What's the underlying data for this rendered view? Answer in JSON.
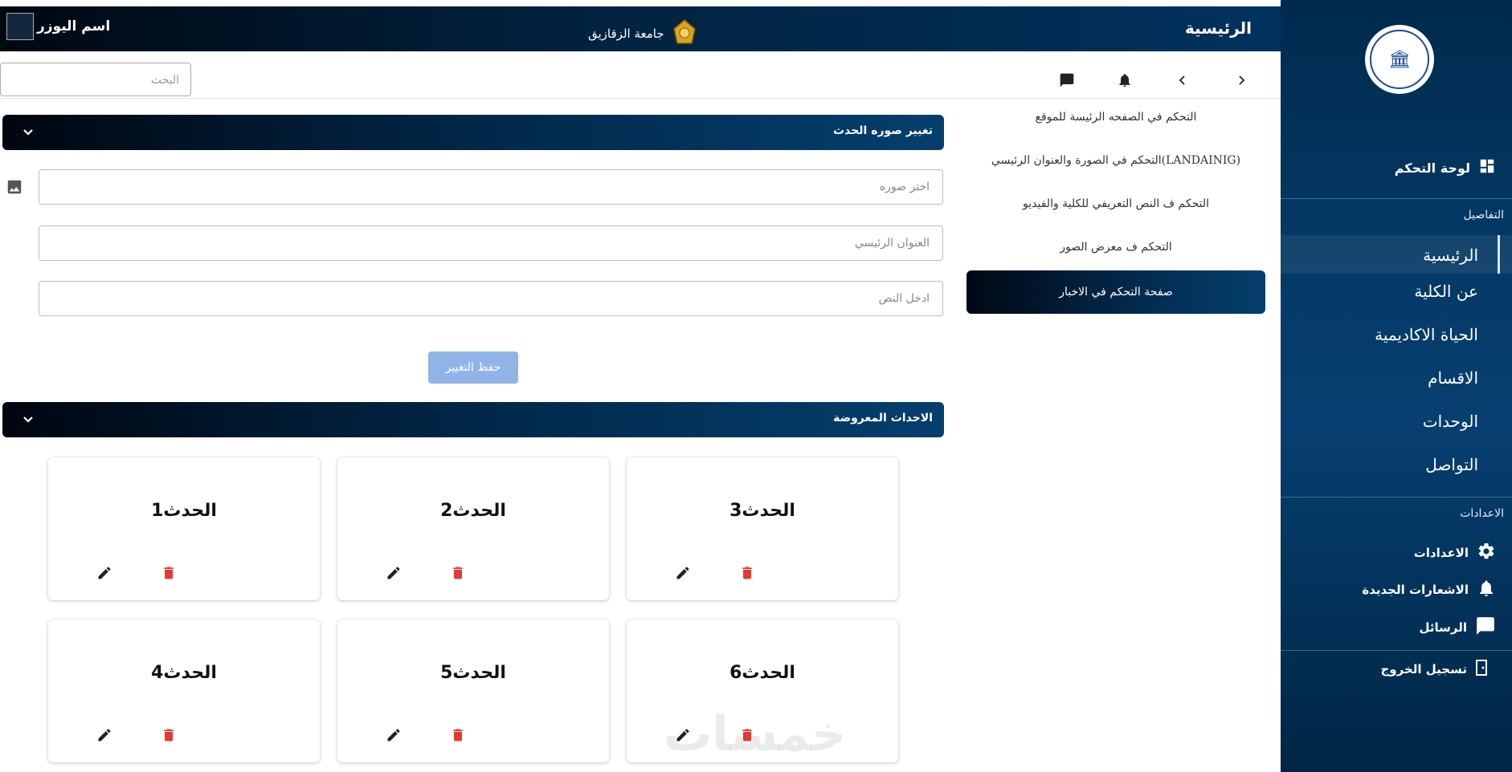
{
  "colors": {
    "sidebar": "#063f70",
    "header_dark": "#000812",
    "header_blue": "#053f6e",
    "save_button": "#90b4e8",
    "delete_icon": "#e53935"
  },
  "topbar": {
    "title": "الرئيسية",
    "university_name": "جامعة الزقازيق",
    "user_name": "اسم اليوزر"
  },
  "toolbar": {
    "search_placeholder": "البحث"
  },
  "sidebar": {
    "dashboard": "لوحة التحكم",
    "details_section": "التفاصيل",
    "nav": [
      "الرئيسية",
      "عن الكلية",
      "الحياة الاكاديمية",
      "الاقسام",
      "الوحدات",
      "التواصل"
    ],
    "settings_section": "الاعدادات",
    "settings": "الاعدادات",
    "notifications": "الاشعارات الجديدة",
    "messages": "الرسائل",
    "logout": "تسجيل الخروج"
  },
  "submenu": {
    "items": [
      "التحكم في الصفحه الرئيسة للموقع",
      "(LANDAINIG)التحكم في الصورة والعنوان الرئيسي",
      "التحكم ف النص التعريفي للكلية والفيديو",
      "التحكم ف معرض الصور"
    ],
    "active": "صفحة التحكم في الاخبار"
  },
  "form": {
    "header": "تغيير صوره الحدث",
    "image_placeholder": "اختر صوره",
    "title_placeholder": "العنوان الرئيسي",
    "text_placeholder": "ادخل النص",
    "save_label": "حفظ التغيير"
  },
  "events": {
    "header": "الاحداث المعروضة",
    "cards": [
      "الحدث1",
      "الحدث2",
      "الحدث3",
      "الحدث4",
      "الحدث5",
      "الحدث6"
    ]
  },
  "watermark": "خمسات"
}
